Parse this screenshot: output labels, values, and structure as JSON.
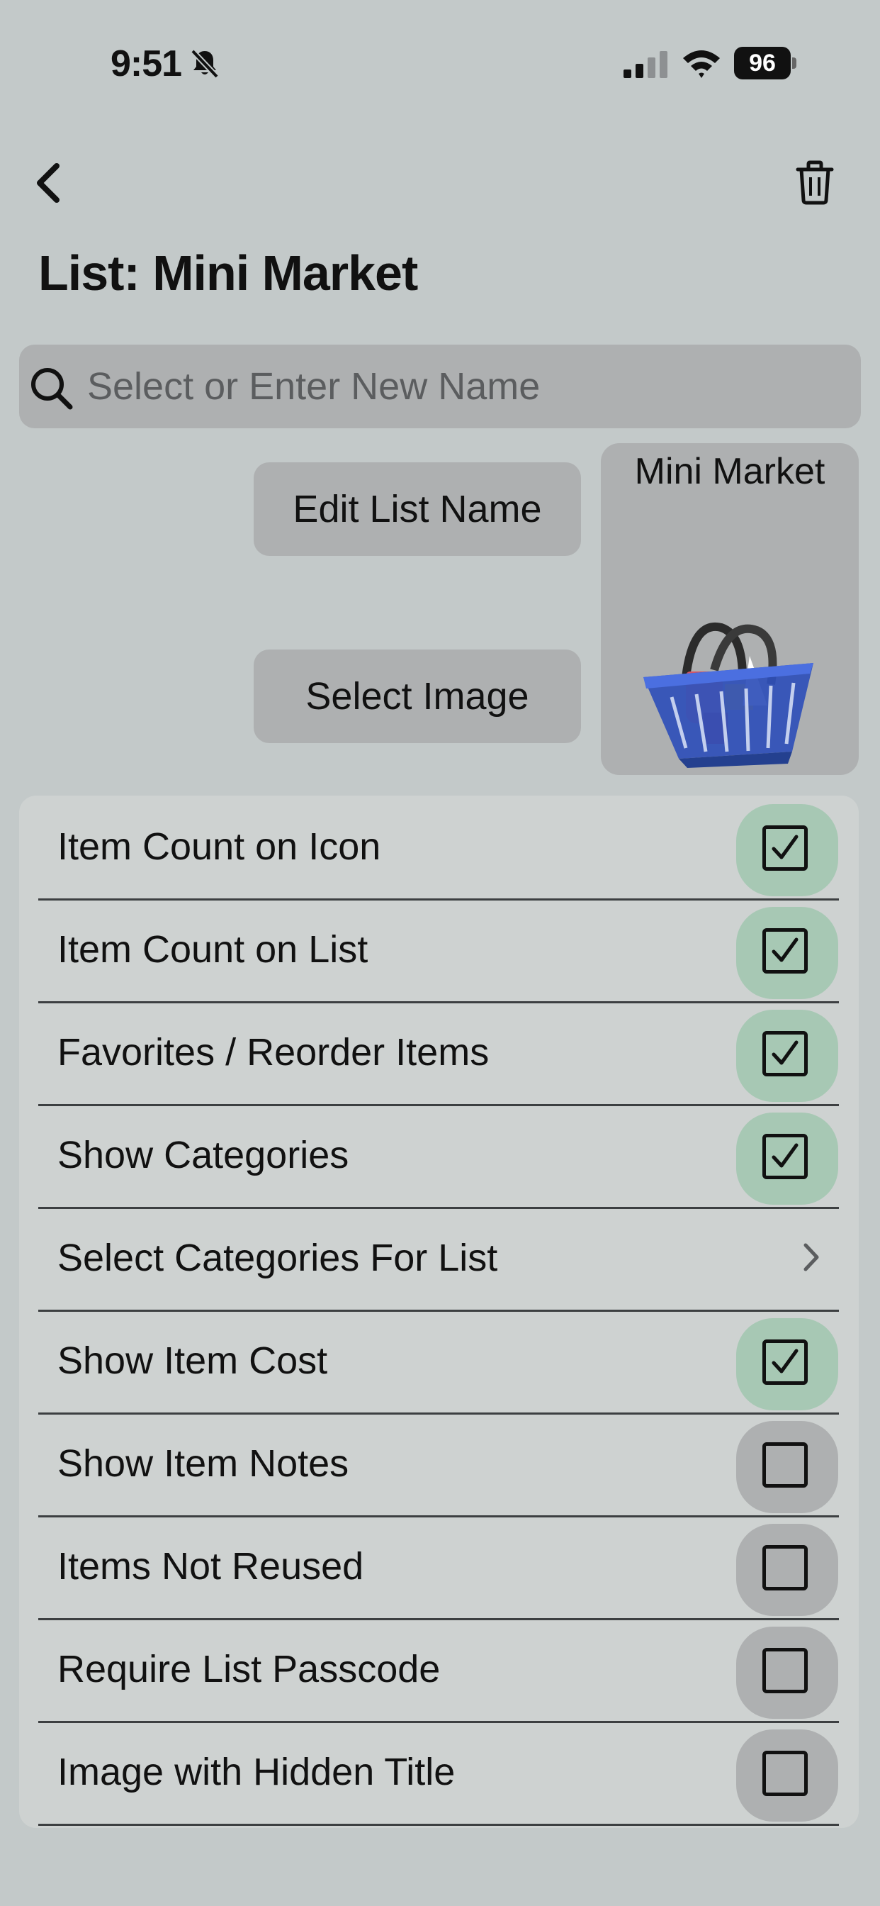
{
  "status_bar": {
    "time": "9:51",
    "battery": "96",
    "icons": [
      "bell-slash-icon",
      "cellular-signal-icon",
      "wifi-icon",
      "battery-icon"
    ]
  },
  "nav": {
    "back_icon": "chevron-left-icon",
    "trash_icon": "trash-icon"
  },
  "page": {
    "title": "List: Mini Market"
  },
  "search": {
    "placeholder": "Select or Enter New Name",
    "value": ""
  },
  "actions": {
    "edit_label": "Edit List Name",
    "image_label": "Select Image"
  },
  "preview": {
    "title": "Mini Market",
    "image_icon": "shopping-basket-icon"
  },
  "settings": {
    "rows": [
      {
        "label": "Item Count on Icon",
        "type": "checkbox",
        "checked": true
      },
      {
        "label": "Item Count on List",
        "type": "checkbox",
        "checked": true
      },
      {
        "label": "Favorites / Reorder Items",
        "type": "checkbox",
        "checked": true
      },
      {
        "label": "Show Categories",
        "type": "checkbox",
        "checked": true
      },
      {
        "label": "Select Categories For List",
        "type": "disclosure"
      },
      {
        "label": "Show Item Cost",
        "type": "checkbox",
        "checked": true
      },
      {
        "label": "Show Item Notes",
        "type": "checkbox",
        "checked": false
      },
      {
        "label": "Items Not Reused",
        "type": "checkbox",
        "checked": false
      },
      {
        "label": "Require List Passcode",
        "type": "checkbox",
        "checked": false
      },
      {
        "label": "Image with Hidden Title",
        "type": "checkbox",
        "checked": false
      }
    ]
  },
  "colors": {
    "background": "#c3c9c9",
    "checked_pill": "#a7c8b4",
    "unchecked_pill": "#aeb0b1",
    "panel": "#ced2d1"
  }
}
